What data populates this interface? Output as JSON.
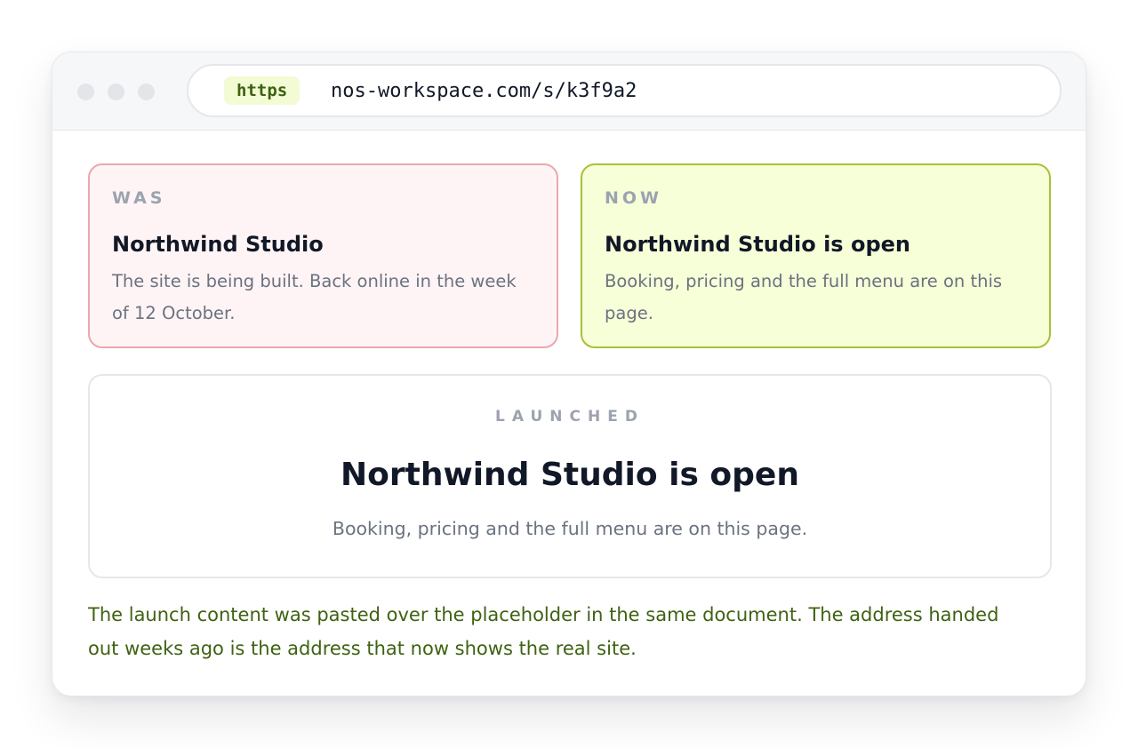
{
  "browser": {
    "scheme_badge": "https",
    "url": "nos-workspace.com/s/k3f9a2"
  },
  "was_card": {
    "label": "WAS",
    "title": "Northwind Studio",
    "body": "The site is being built. Back online in the week of 12 October."
  },
  "now_card": {
    "label": "NOW",
    "title": "Northwind Studio is open",
    "body": "Booking, pricing and the full menu are on this page."
  },
  "hero": {
    "label": "LAUNCHED",
    "title": "Northwind Studio is open",
    "body": "Booking, pricing and the full menu are on this page."
  },
  "note": "The launch content was pasted over the placeholder in the same document. The address handed out weeks ago is the address that now shows the real site.",
  "colors": {
    "accent_green": "#3f6212",
    "was_border": "#e9a8ae",
    "now_border": "#a8c236"
  }
}
